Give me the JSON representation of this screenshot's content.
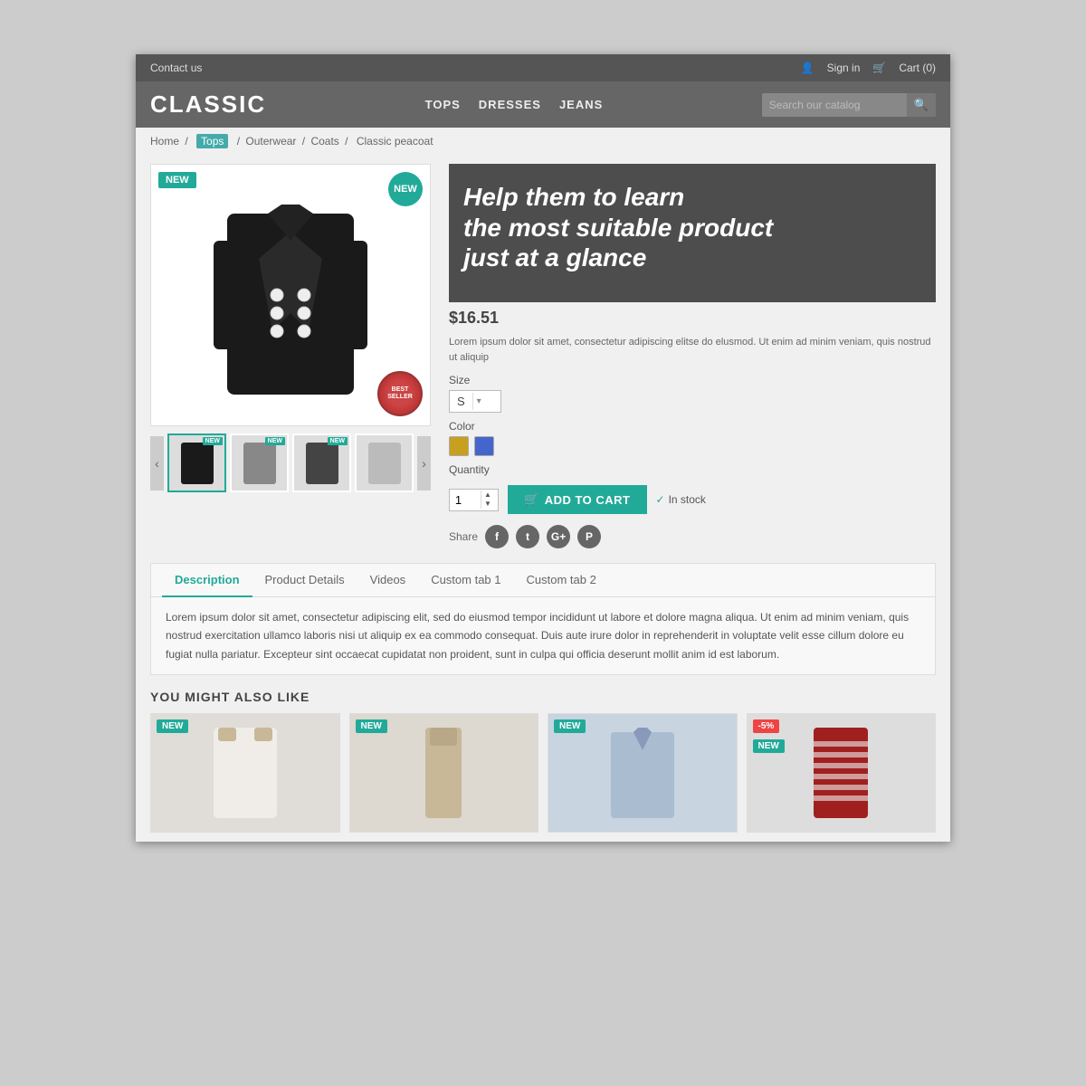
{
  "topbar": {
    "contact": "Contact us",
    "signin": "Sign in",
    "cart": "Cart (0)"
  },
  "header": {
    "logo": "CLASSIC",
    "nav": {
      "tops": "TOPS",
      "dresses": "DRESSES",
      "jeans": "JEANS"
    },
    "search_placeholder": "Search our catalog"
  },
  "breadcrumb": {
    "home": "Home",
    "tops": "Tops",
    "outerwear": "Outerwear",
    "coats": "Coats",
    "product": "Classic peacoat"
  },
  "product": {
    "name": "Classic peacoat",
    "price": "$16.51",
    "description": "Lorem ipsum dolor sit amet, consectetur adipiscing elitse do elusmod. Ut enim ad minim veniam, quis nostrud ut aliquip",
    "size_label": "Size",
    "size_value": "S",
    "color_label": "Color",
    "quantity_label": "Quantity",
    "quantity_value": "1",
    "add_to_cart": "ADD TO CART",
    "in_stock": "In stock",
    "share_label": "Share"
  },
  "promo": {
    "headline": "Help them to learn\nthe most suitable product\njust at a glance"
  },
  "tabs": {
    "description": "Description",
    "product_details": "Product Details",
    "videos": "Videos",
    "custom_tab_1": "Custom tab 1",
    "custom_tab_2": "Custom tab 2",
    "description_text": "Lorem ipsum dolor sit amet, consectetur adipiscing elit, sed do eiusmod tempor incididunt ut labore et dolore magna aliqua. Ut enim ad minim veniam, quis nostrud exercitation ullamco laboris nisi ut aliquip ex ea commodo consequat. Duis aute irure dolor in reprehenderit in voluptate velit esse cillum dolore eu fugiat nulla pariatur. Excepteur sint occaecat cupidatat non proident, sunt in culpa qui officia deserunt mollit anim id est laborum."
  },
  "related": {
    "title": "YOU MIGHT ALSO LIKE",
    "items": [
      {
        "badge": "NEW",
        "bg": "#d4ccc0"
      },
      {
        "badge": "NEW",
        "bg": "#c8b8a8"
      },
      {
        "badge": "NEW",
        "bg": "#b8c8d8"
      },
      {
        "badge": "-5%",
        "badge2": "NEW",
        "bg": "#c44444"
      }
    ]
  }
}
